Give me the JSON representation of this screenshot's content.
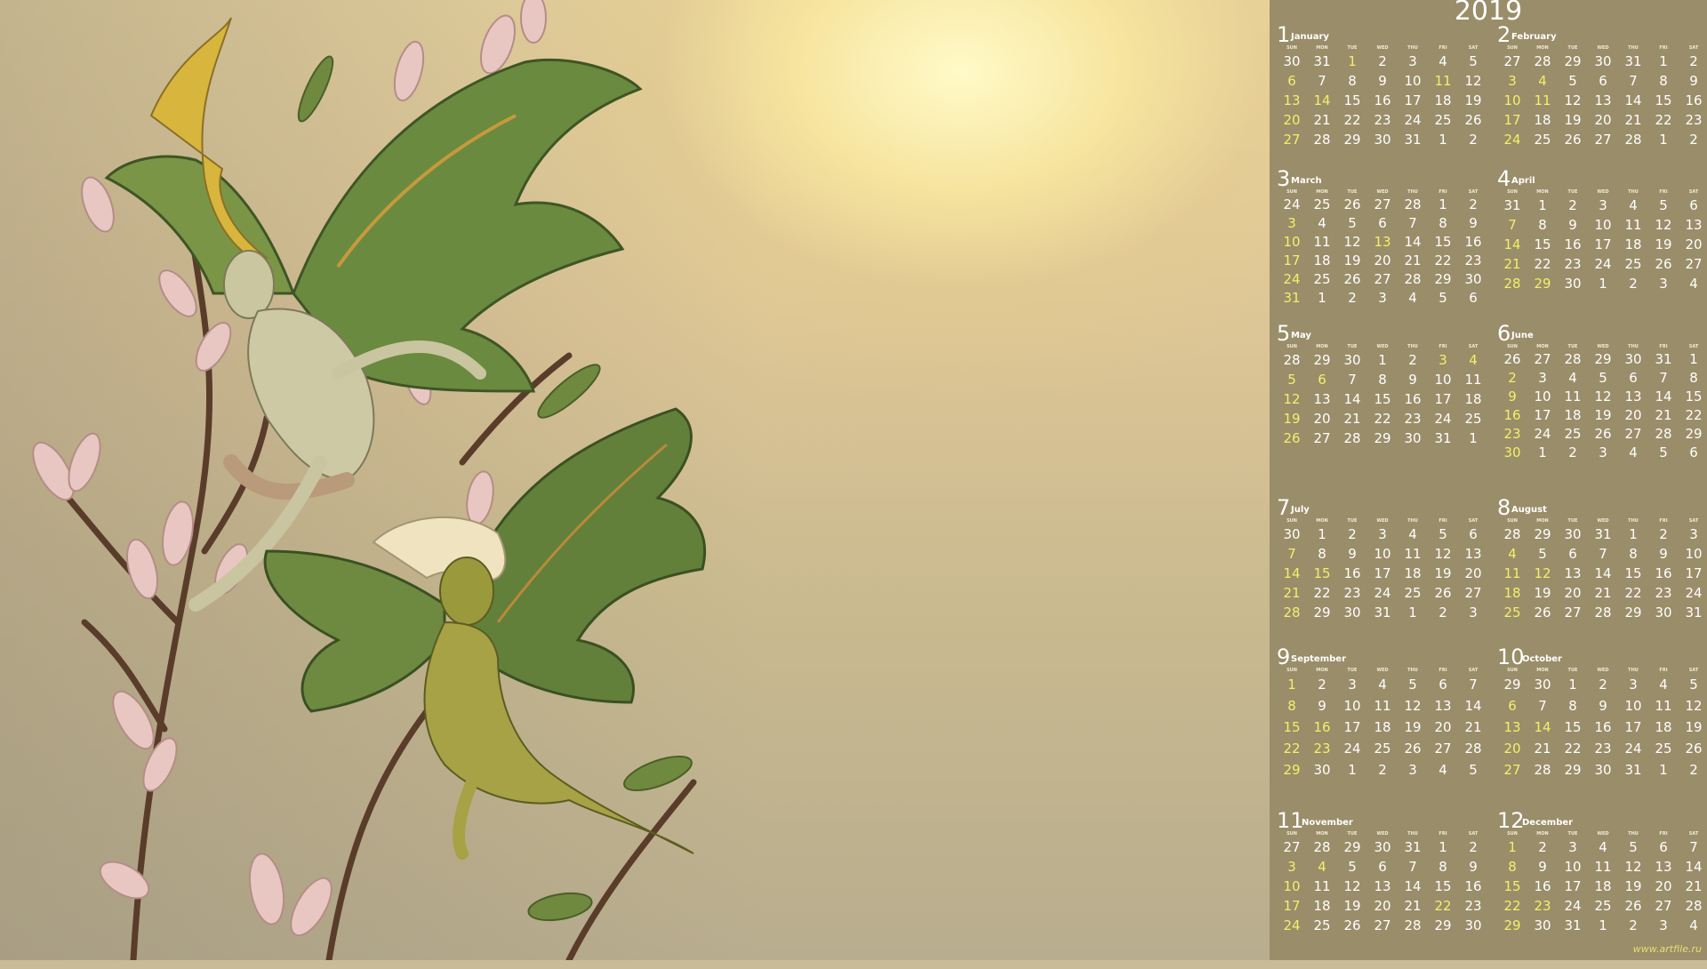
{
  "calendar": {
    "year": "2019",
    "weekdays": [
      "SUN",
      "MON",
      "TUE",
      "WED",
      "THU",
      "FRI",
      "SAT"
    ],
    "months": [
      {
        "num": "1",
        "name": "January",
        "days": [
          "30",
          "31",
          "1",
          "2",
          "3",
          "4",
          "5",
          "6",
          "7",
          "8",
          "9",
          "10",
          "11",
          "12",
          "13",
          "14",
          "15",
          "16",
          "17",
          "18",
          "19",
          "20",
          "21",
          "22",
          "23",
          "24",
          "25",
          "26",
          "27",
          "28",
          "29",
          "30",
          "31",
          "1",
          "2"
        ],
        "highlight": [
          2,
          7,
          12,
          14,
          15,
          21,
          28
        ]
      },
      {
        "num": "2",
        "name": "February",
        "days": [
          "27",
          "28",
          "29",
          "30",
          "31",
          "1",
          "2",
          "3",
          "4",
          "5",
          "6",
          "7",
          "8",
          "9",
          "10",
          "11",
          "12",
          "13",
          "14",
          "15",
          "16",
          "17",
          "18",
          "19",
          "20",
          "21",
          "22",
          "23",
          "24",
          "25",
          "26",
          "27",
          "28",
          "1",
          "2"
        ],
        "highlight": [
          7,
          8,
          14,
          15,
          21,
          28
        ]
      },
      {
        "num": "3",
        "name": "March",
        "days": [
          "24",
          "25",
          "26",
          "27",
          "28",
          "1",
          "2",
          "3",
          "4",
          "5",
          "6",
          "7",
          "8",
          "9",
          "10",
          "11",
          "12",
          "13",
          "14",
          "15",
          "16",
          "17",
          "18",
          "19",
          "20",
          "21",
          "22",
          "23",
          "24",
          "25",
          "26",
          "27",
          "28",
          "29",
          "30",
          "31",
          "1",
          "2",
          "3",
          "4",
          "5",
          "6"
        ],
        "highlight": [
          7,
          14,
          17,
          21,
          28,
          35
        ]
      },
      {
        "num": "4",
        "name": "April",
        "days": [
          "31",
          "1",
          "2",
          "3",
          "4",
          "5",
          "6",
          "7",
          "8",
          "9",
          "10",
          "11",
          "12",
          "13",
          "14",
          "15",
          "16",
          "17",
          "18",
          "19",
          "20",
          "21",
          "22",
          "23",
          "24",
          "25",
          "26",
          "27",
          "28",
          "29",
          "30",
          "1",
          "2",
          "3",
          "4"
        ],
        "highlight": [
          7,
          14,
          21,
          28,
          29
        ]
      },
      {
        "num": "5",
        "name": "May",
        "days": [
          "28",
          "29",
          "30",
          "1",
          "2",
          "3",
          "4",
          "5",
          "6",
          "7",
          "8",
          "9",
          "10",
          "11",
          "12",
          "13",
          "14",
          "15",
          "16",
          "17",
          "18",
          "19",
          "20",
          "21",
          "22",
          "23",
          "24",
          "25",
          "26",
          "27",
          "28",
          "29",
          "30",
          "31",
          "1"
        ],
        "highlight": [
          5,
          6,
          7,
          8,
          14,
          21,
          28
        ]
      },
      {
        "num": "6",
        "name": "June",
        "days": [
          "26",
          "27",
          "28",
          "29",
          "30",
          "31",
          "1",
          "2",
          "3",
          "4",
          "5",
          "6",
          "7",
          "8",
          "9",
          "10",
          "11",
          "12",
          "13",
          "14",
          "15",
          "16",
          "17",
          "18",
          "19",
          "20",
          "21",
          "22",
          "23",
          "24",
          "25",
          "26",
          "27",
          "28",
          "29",
          "30",
          "1",
          "2",
          "3",
          "4",
          "5",
          "6"
        ],
        "highlight": [
          7,
          14,
          21,
          28,
          35
        ]
      },
      {
        "num": "7",
        "name": "July",
        "days": [
          "30",
          "1",
          "2",
          "3",
          "4",
          "5",
          "6",
          "7",
          "8",
          "9",
          "10",
          "11",
          "12",
          "13",
          "14",
          "15",
          "16",
          "17",
          "18",
          "19",
          "20",
          "21",
          "22",
          "23",
          "24",
          "25",
          "26",
          "27",
          "28",
          "29",
          "30",
          "31",
          "1",
          "2",
          "3"
        ],
        "highlight": [
          7,
          14,
          15,
          21,
          28
        ]
      },
      {
        "num": "8",
        "name": "August",
        "days": [
          "28",
          "29",
          "30",
          "31",
          "1",
          "2",
          "3",
          "4",
          "5",
          "6",
          "7",
          "8",
          "9",
          "10",
          "11",
          "12",
          "13",
          "14",
          "15",
          "16",
          "17",
          "18",
          "19",
          "20",
          "21",
          "22",
          "23",
          "24",
          "25",
          "26",
          "27",
          "28",
          "29",
          "30",
          "31"
        ],
        "highlight": [
          7,
          14,
          15,
          21,
          28
        ]
      },
      {
        "num": "9",
        "name": "September",
        "days": [
          "1",
          "2",
          "3",
          "4",
          "5",
          "6",
          "7",
          "8",
          "9",
          "10",
          "11",
          "12",
          "13",
          "14",
          "15",
          "16",
          "17",
          "18",
          "19",
          "20",
          "21",
          "22",
          "23",
          "24",
          "25",
          "26",
          "27",
          "28",
          "29",
          "30",
          "1",
          "2",
          "3",
          "4",
          "5"
        ],
        "highlight": [
          0,
          7,
          14,
          15,
          21,
          22,
          28
        ]
      },
      {
        "num": "10",
        "name": "October",
        "days": [
          "29",
          "30",
          "1",
          "2",
          "3",
          "4",
          "5",
          "6",
          "7",
          "8",
          "9",
          "10",
          "11",
          "12",
          "13",
          "14",
          "15",
          "16",
          "17",
          "18",
          "19",
          "20",
          "21",
          "22",
          "23",
          "24",
          "25",
          "26",
          "27",
          "28",
          "29",
          "30",
          "31",
          "1",
          "2"
        ],
        "highlight": [
          7,
          14,
          15,
          21,
          28
        ]
      },
      {
        "num": "11",
        "name": "November",
        "days": [
          "27",
          "28",
          "29",
          "30",
          "31",
          "1",
          "2",
          "3",
          "4",
          "5",
          "6",
          "7",
          "8",
          "9",
          "10",
          "11",
          "12",
          "13",
          "14",
          "15",
          "16",
          "17",
          "18",
          "19",
          "20",
          "21",
          "22",
          "23",
          "24",
          "25",
          "26",
          "27",
          "28",
          "29",
          "30"
        ],
        "highlight": [
          7,
          8,
          14,
          21,
          26,
          28
        ]
      },
      {
        "num": "12",
        "name": "December",
        "days": [
          "1",
          "2",
          "3",
          "4",
          "5",
          "6",
          "7",
          "8",
          "9",
          "10",
          "11",
          "12",
          "13",
          "14",
          "15",
          "16",
          "17",
          "18",
          "19",
          "20",
          "21",
          "22",
          "23",
          "24",
          "25",
          "26",
          "27",
          "28",
          "29",
          "30",
          "31",
          "1",
          "2",
          "3",
          "4"
        ],
        "highlight": [
          0,
          7,
          14,
          21,
          22,
          28
        ]
      }
    ]
  },
  "watermark": "www.artfile.ru",
  "colors": {
    "panel": "#9a8d69",
    "weekend": "#f4ef6c",
    "text": "#ffffff"
  }
}
